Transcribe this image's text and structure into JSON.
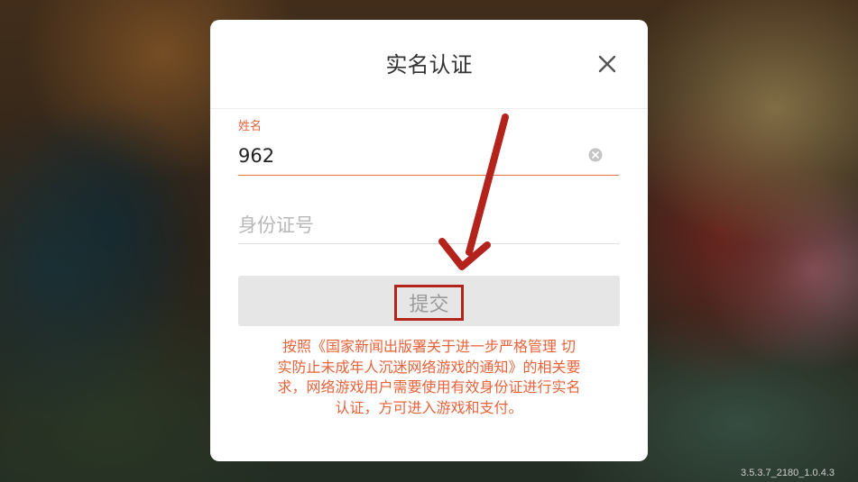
{
  "dialog": {
    "title": "实名认证",
    "name_label": "姓名",
    "name_value": "962",
    "id_placeholder": "身份证号",
    "submit_label": "提交",
    "notice_lines": [
      "按照《国家新闻出版署关于进一步严格管理 切",
      "实防止未成年人沉迷网络游戏的通知》的相关要",
      "求，网络游戏用户需要使用有效身份证进行实名",
      "认证，方可进入游戏和支付。"
    ]
  },
  "version": "3.5.3.7_2180_1.0.4.3",
  "colors": {
    "accent": "#e8623a",
    "annotation": "#b3231c",
    "submit_bg": "#e6e6e6"
  },
  "icons": {
    "close": "close-icon",
    "clear": "clear-input-icon",
    "annotation_arrow": "arrow-icon"
  }
}
